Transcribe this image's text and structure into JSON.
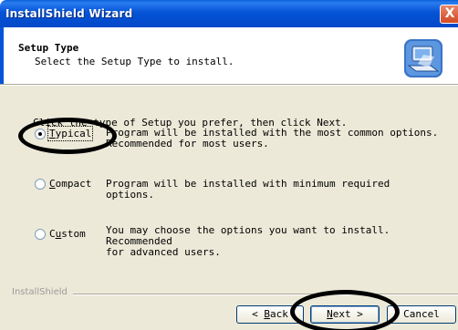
{
  "window": {
    "title": "InstallShield Wizard",
    "close_label": "X"
  },
  "header": {
    "title": "Setup Type",
    "subtitle": "Select the Setup Type to install."
  },
  "instruction": "Click the type of Setup you prefer, then click Next.",
  "options": [
    {
      "label_hotkey": "T",
      "label_rest": "ypical",
      "checked": true,
      "description": "Program will be installed with the most common options.\nRecommended for most users."
    },
    {
      "label_hotkey": "C",
      "label_rest": "ompact",
      "checked": false,
      "description": "Program will be installed with minimum required options."
    },
    {
      "label_pre": "C",
      "label_hotkey": "u",
      "label_rest": "stom",
      "checked": false,
      "description": "You may choose the options you want to install. Recommended\nfor advanced users."
    }
  ],
  "footer": {
    "brand": "InstallShield"
  },
  "buttons": {
    "back_pre": "< ",
    "back_hotkey": "B",
    "back_rest": "ack",
    "next_hotkey": "N",
    "next_rest": "ext >",
    "cancel": "Cancel"
  }
}
